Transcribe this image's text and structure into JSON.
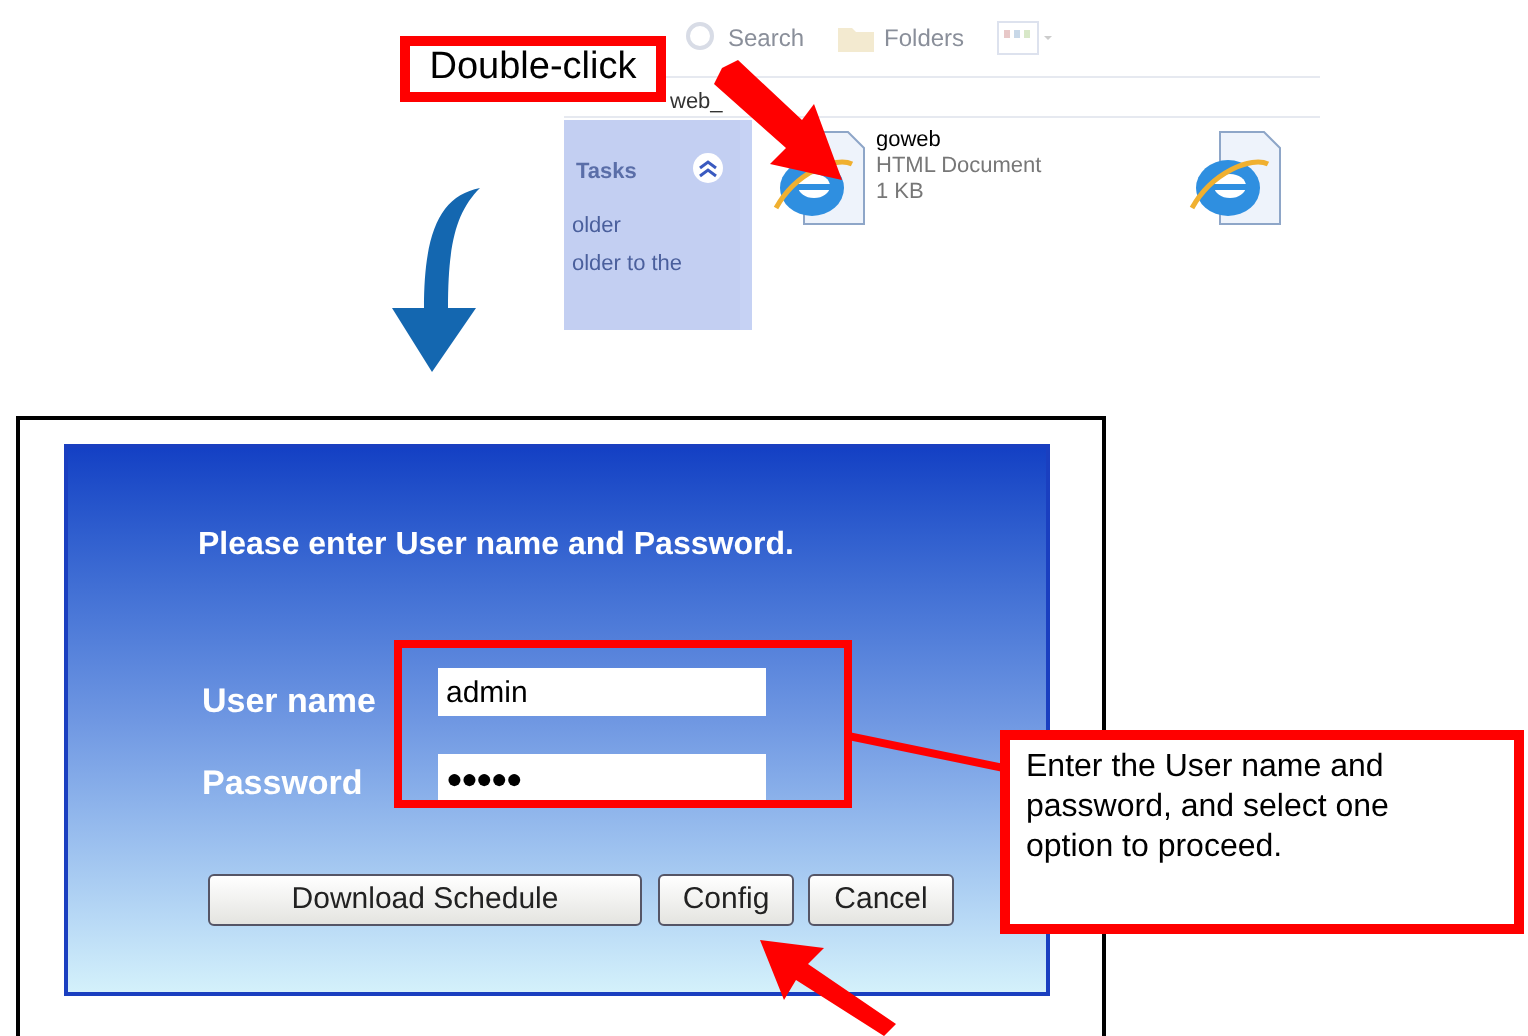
{
  "explorer": {
    "toolbar": [
      {
        "kind": "search",
        "label": "Search"
      },
      {
        "kind": "folders",
        "label": "Folders"
      },
      {
        "kind": "views"
      }
    ],
    "address": "web_",
    "tasks_panel": {
      "title": "Tasks",
      "expanded": true,
      "items": [
        "older",
        "older to the"
      ]
    },
    "files": [
      {
        "kind": "html",
        "name": "goweb",
        "type": "HTML Document",
        "size": "1 KB"
      },
      {
        "kind": "html"
      }
    ]
  },
  "double_click_callout": "Double-click",
  "login": {
    "title": "Please enter User name and Password.",
    "fields": [
      {
        "kind": "text",
        "label": "User name",
        "value": "admin"
      },
      {
        "kind": "password",
        "label": "Password",
        "value": "●●●●●"
      }
    ],
    "buttons": [
      "Download Schedule",
      "Config",
      "Cancel"
    ]
  },
  "note_callout": "Enter the User name and password, and select one option to proceed."
}
